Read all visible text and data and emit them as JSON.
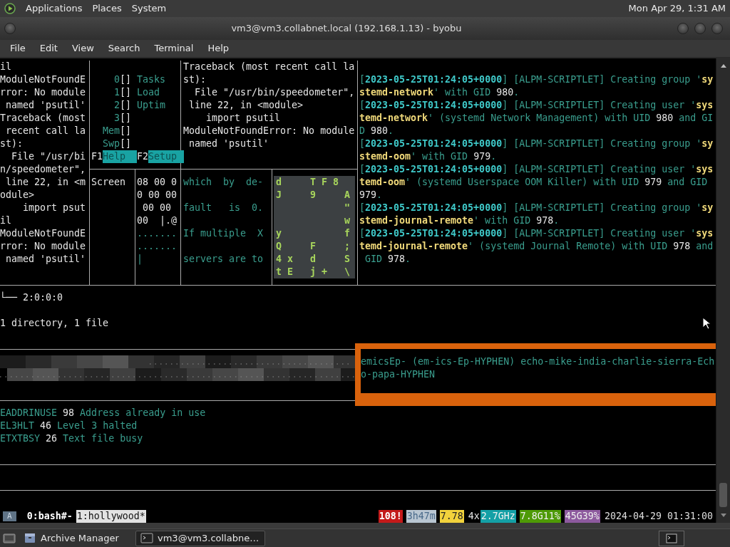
{
  "top_panel": {
    "menus": [
      "Applications",
      "Places",
      "System"
    ],
    "clock": "Mon Apr 29, 1:31 AM"
  },
  "window": {
    "title": "vm3@vm3.collabnet.local (192.168.1.13) - byobu"
  },
  "menu_bar": [
    "File",
    "Edit",
    "View",
    "Search",
    "Terminal",
    "Help"
  ],
  "terminal": {
    "left_pane": {
      "lines": [
        "il",
        "ModuleNotFoundError: No module named 'psutil'",
        "Traceback (most recent call last):",
        "  File \"/usr/bin/speedometer\", line 22, in <module>",
        "    import psutil",
        "ModuleNotFoundError: No module named 'psutil'"
      ]
    },
    "htop": {
      "meters": [
        {
          "label": "0",
          "bar": "[]",
          "legend": "Tasks"
        },
        {
          "label": "1",
          "bar": "[]",
          "legend": "Load"
        },
        {
          "label": "2",
          "bar": "[]",
          "legend": "Uptim"
        },
        {
          "label": "3",
          "bar": "[]"
        },
        {
          "label": "Mem",
          "bar": "[]"
        },
        {
          "label": "Swp",
          "bar": "[]"
        }
      ],
      "function_keys": [
        {
          "key": "F1",
          "label": "Help"
        },
        {
          "key": "F2",
          "label": "Setup"
        }
      ]
    },
    "screen_pane": {
      "text": "Screen"
    },
    "hex_pane": {
      "lines": [
        {
          "text": "08 00 0",
          "kind": "plain"
        },
        {
          "text": "0 00 00",
          "kind": "plain"
        },
        {
          "text": " 00 00",
          "kind": "plain"
        },
        {
          "text": "00  |.@",
          "kind": "plain"
        },
        {
          "text": ".......",
          "kind": "dim"
        },
        {
          "text": ".......",
          "kind": "dim"
        },
        {
          "text": "|",
          "kind": "dim"
        }
      ]
    },
    "traceback_pane": {
      "lines": [
        "Traceback (most recent call last):",
        "  File \"/usr/bin/speedometer\", line 22, in <module>",
        "    import psutil",
        "ModuleNotFoundError: No module named 'psutil'"
      ]
    },
    "man_pane": {
      "lines": [
        "which  by  de-",
        "fault   is  0.",
        "If multiple  X",
        "servers are to"
      ]
    },
    "matrix_pane": {
      "rows": [
        "d     T F 8",
        "J     9     A",
        "            \"",
        "            w",
        "y           f",
        "Q     F     ;",
        "4 x   d     S",
        "t E   j +   \\"
      ]
    },
    "log_pane": {
      "entries": [
        {
          "segments": [
            {
              "text": "[",
              "kind": "dim"
            },
            {
              "text": "2023-05-25T01:24:05+0000",
              "kind": "stamp"
            },
            {
              "text": "] [ALPM-SCRIPTLET] Creating group '",
              "kind": "dim"
            },
            {
              "text": "systemd-network",
              "kind": "name"
            },
            {
              "text": "' with GID ",
              "kind": "dim"
            },
            {
              "text": "980",
              "kind": "plain"
            },
            {
              "text": ".",
              "kind": "dim"
            }
          ]
        },
        {
          "segments": [
            {
              "text": "[",
              "kind": "dim"
            },
            {
              "text": "2023-05-25T01:24:05+0000",
              "kind": "stamp"
            },
            {
              "text": "] [ALPM-SCRIPTLET] Creating user '",
              "kind": "dim"
            },
            {
              "text": "systemd-network",
              "kind": "name"
            },
            {
              "text": "' (systemd Network Management) with UID ",
              "kind": "dim"
            },
            {
              "text": "980",
              "kind": "plain"
            },
            {
              "text": " and GID ",
              "kind": "dim"
            },
            {
              "text": "980",
              "kind": "plain"
            },
            {
              "text": ".",
              "kind": "dim"
            }
          ]
        },
        {
          "segments": [
            {
              "text": "[",
              "kind": "dim"
            },
            {
              "text": "2023-05-25T01:24:05+0000",
              "kind": "stamp"
            },
            {
              "text": "] [ALPM-SCRIPTLET] Creating group '",
              "kind": "dim"
            },
            {
              "text": "systemd-oom",
              "kind": "name"
            },
            {
              "text": "' with GID ",
              "kind": "dim"
            },
            {
              "text": "979",
              "kind": "plain"
            },
            {
              "text": ".",
              "kind": "dim"
            }
          ]
        },
        {
          "segments": [
            {
              "text": "[",
              "kind": "dim"
            },
            {
              "text": "2023-05-25T01:24:05+0000",
              "kind": "stamp"
            },
            {
              "text": "] [ALPM-SCRIPTLET] Creating user '",
              "kind": "dim"
            },
            {
              "text": "systemd-oom",
              "kind": "name"
            },
            {
              "text": "' (systemd Userspace OOM Killer) with UID ",
              "kind": "dim"
            },
            {
              "text": "979",
              "kind": "plain"
            },
            {
              "text": " and GID ",
              "kind": "dim"
            },
            {
              "text": "979",
              "kind": "plain"
            },
            {
              "text": ".",
              "kind": "dim"
            }
          ]
        },
        {
          "segments": [
            {
              "text": "[",
              "kind": "dim"
            },
            {
              "text": "2023-05-25T01:24:05+0000",
              "kind": "stamp"
            },
            {
              "text": "] [ALPM-SCRIPTLET] Creating group '",
              "kind": "dim"
            },
            {
              "text": "systemd-journal-remote",
              "kind": "name"
            },
            {
              "text": "' with GID ",
              "kind": "dim"
            },
            {
              "text": "978",
              "kind": "plain"
            },
            {
              "text": ".",
              "kind": "dim"
            }
          ]
        },
        {
          "segments": [
            {
              "text": "[",
              "kind": "dim"
            },
            {
              "text": "2023-05-25T01:24:05+0000",
              "kind": "stamp"
            },
            {
              "text": "] [ALPM-SCRIPTLET] Creating user '",
              "kind": "dim"
            },
            {
              "text": "systemd-journal-remote",
              "kind": "name"
            },
            {
              "text": "' (systemd Journal Remote) with UID ",
              "kind": "dim"
            },
            {
              "text": "978",
              "kind": "plain"
            },
            {
              "text": " and GID ",
              "kind": "dim"
            },
            {
              "text": "978",
              "kind": "plain"
            },
            {
              "text": ".",
              "kind": "dim"
            }
          ]
        }
      ]
    },
    "tree_output": {
      "branch": "└── 2:0:0:0",
      "summary": "1 directory, 1 file"
    },
    "announce_pane": {
      "text": "emicsEp- (em-ics-Ep-HYPHEN) echo-mike-india-charlie-sierra-Echo-papa-HYPHEN",
      "active": true
    },
    "errno_lines": [
      {
        "name": "EADDRINUSE",
        "code": "98",
        "message": "Address already in use"
      },
      {
        "name": "EL3HLT",
        "code": "46",
        "message": "Level 3 halted"
      },
      {
        "name": "ETXTBSY",
        "code": "26",
        "message": "Text file busy"
      }
    ],
    "status_bar": {
      "session": "A",
      "windows": [
        {
          "label": "0:bash#-",
          "selected": false
        },
        {
          "label": "1:hollywood*",
          "selected": true
        }
      ],
      "indicators": [
        {
          "text": "108!",
          "kind": "alert"
        },
        {
          "text": "3h47m",
          "kind": "uptime"
        },
        {
          "text": "7.78",
          "kind": "load"
        },
        {
          "text": "4x",
          "kind": "plain"
        },
        {
          "text": "2.7GHz",
          "kind": "cpu"
        },
        {
          "text": "7.8G11%",
          "kind": "memory"
        },
        {
          "text": "45G39%",
          "kind": "disk"
        },
        {
          "text": "2024-04-29 01:31:00",
          "kind": "clock"
        }
      ]
    }
  },
  "taskbar": {
    "buttons": [
      {
        "label": "Archive Manager",
        "selected": false
      },
      {
        "label": "vm3@vm3.collabne…",
        "selected": true
      }
    ]
  }
}
